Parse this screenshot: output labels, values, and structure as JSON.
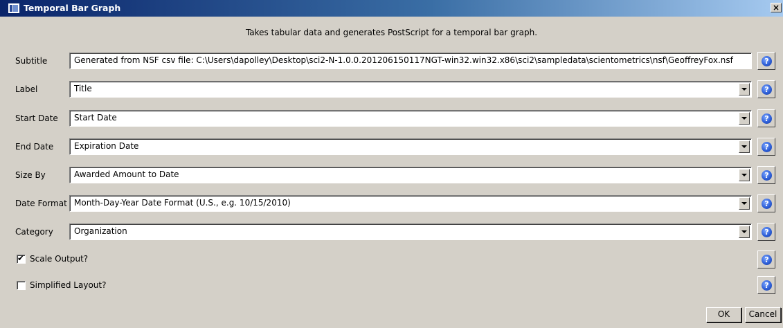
{
  "window": {
    "title": "Temporal Bar Graph",
    "close_label": "×"
  },
  "description": "Takes tabular data and generates PostScript for a temporal bar graph.",
  "fields": [
    {
      "label": "Subtitle",
      "value": "Generated from NSF csv file: C:\\Users\\dapolley\\Desktop\\sci2-N-1.0.0.201206150117NGT-win32.win32.x86\\sci2\\sampledata\\scientometrics\\nsf\\GeoffreyFox.nsf",
      "kind": "text"
    },
    {
      "label": "Label",
      "value": "Title",
      "kind": "select"
    },
    {
      "label": "Start Date",
      "value": "Start Date",
      "kind": "select"
    },
    {
      "label": "End Date",
      "value": "Expiration Date",
      "kind": "select"
    },
    {
      "label": "Size By",
      "value": "Awarded Amount to Date",
      "kind": "select"
    },
    {
      "label": "Date Format",
      "value": "Month-Day-Year Date Format (U.S., e.g. 10/15/2010)",
      "kind": "select"
    },
    {
      "label": "Category",
      "value": "Organization",
      "kind": "select"
    }
  ],
  "checkboxes": [
    {
      "label": "Scale Output?",
      "checked": true,
      "mark": "✔"
    },
    {
      "label": "Simplified Layout?",
      "checked": false,
      "mark": ""
    }
  ],
  "help_glyph": "?",
  "buttons": {
    "ok": "OK",
    "cancel": "Cancel"
  },
  "colors": {
    "dialog_bg": "#d4d0c8",
    "titlebar_start": "#0a246a",
    "titlebar_end": "#a6caf0",
    "help_icon": "#2e5fd8"
  }
}
